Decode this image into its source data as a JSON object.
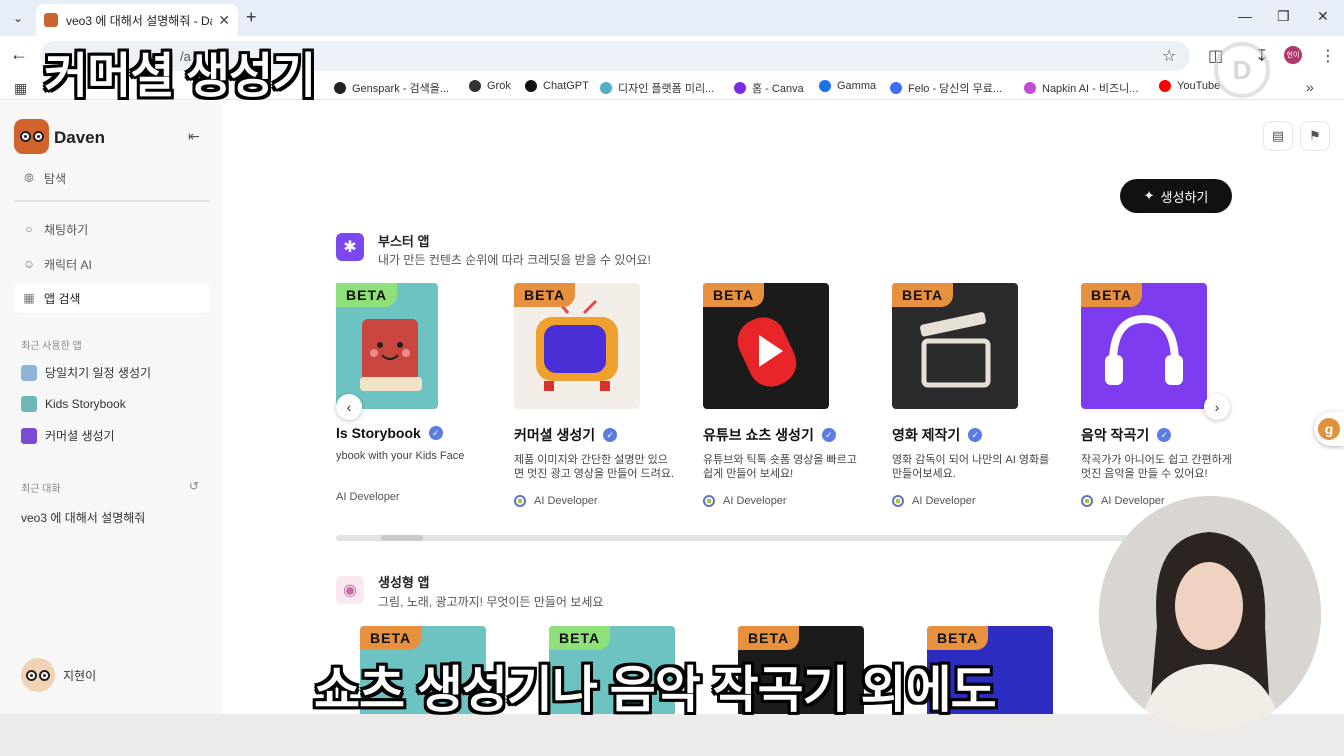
{
  "browser": {
    "tab_title": "veo3 에 대해서 설명해줘 - Da",
    "url_fragment": "/a",
    "profile_label": "현이"
  },
  "bookmarks": [
    {
      "label": "Genspark - 검색을...",
      "color": "#222222"
    },
    {
      "label": "Grok",
      "color": "#333333"
    },
    {
      "label": "ChatGPT",
      "color": "#111111"
    },
    {
      "label": "디자인 플랫폼 미리...",
      "color": "#4fb0c6"
    },
    {
      "label": "홈 - Canva",
      "color": "#7d2ae8"
    },
    {
      "label": "Gamma",
      "color": "#1a73e8"
    },
    {
      "label": "Felo - 당신의 무료...",
      "color": "#3b6ef5"
    },
    {
      "label": "Napkin AI - 비즈니...",
      "color": "#c04bd0"
    },
    {
      "label": "YouTube",
      "color": "#ff0000"
    }
  ],
  "captions": {
    "top": "커머셜 생성기",
    "bottom": "쇼츠 생성기나 음악 작곡기 외에도",
    "watermark": "D"
  },
  "sidebar": {
    "brand": "Daven",
    "explore": "탐색",
    "nav": [
      {
        "label": "채팅하기",
        "icon": "chat-icon"
      },
      {
        "label": "캐릭터 AI",
        "icon": "person-icon"
      },
      {
        "label": "앱 검색",
        "icon": "grid-icon"
      }
    ],
    "recent_apps_title": "최근 사용한 앱",
    "recent_apps": [
      {
        "label": "당일치기 일정 생성기",
        "color": "#8fb6d8"
      },
      {
        "label": "Kids Storybook",
        "color": "#6fb7b4"
      },
      {
        "label": "커머셜 생성기",
        "color": "#7b4bd6"
      }
    ],
    "recent_chats_title": "최근 대화",
    "recent_chats": [
      "veo3 에 대해서 설명해줘"
    ],
    "user_name": "지현이"
  },
  "main": {
    "create_button": "생성하기",
    "booster": {
      "title": "부스터 앱",
      "subtitle": "내가 만든 컨텐츠 순위에 따라 크레딧을 받을 수 있어요!"
    },
    "generative": {
      "title": "생성형 앱",
      "subtitle": "그림, 노래, 광고까지! 무엇이든 만들어 보세요"
    },
    "beta_label": "BETA",
    "cards": [
      {
        "name": "ls Storybook",
        "desc": "ybook with your Kids Face",
        "dev": "AI Developer",
        "bg": "#6cc3c1",
        "badge": "#8ee07a"
      },
      {
        "name": "커머셜 생성기",
        "desc": "제품 이미지와 간단한 설명만 있으\n면 멋진 광고 영상을 만들어 드려요.",
        "dev": "AI Developer",
        "bg": "#f3eee8",
        "badge": "#e7913f"
      },
      {
        "name": "유튜브 쇼츠 생성기",
        "desc": "유튜브와 틱톡 숏폼 영상을 빠르고\n쉽게 만들어 보세요!",
        "dev": "AI Developer",
        "bg": "#1b1b1b",
        "badge": "#e7913f"
      },
      {
        "name": "영화 제작기",
        "desc": "영화 감독이 되어 나만의 AI 영화를\n만들어보세요.",
        "dev": "AI Developer",
        "bg": "#2b2b2b",
        "badge": "#e7913f"
      },
      {
        "name": "음악 작곡기",
        "desc": "작곡가가 아니어도 쉽고 간편하게\n멋진 음악을 만들 수 있어요!",
        "dev": "AI Developer",
        "bg": "#7d3cf0",
        "badge": "#e7913f"
      }
    ],
    "generative_cards": [
      {
        "bg": "#6cc3c1",
        "badge": "#e7913f"
      },
      {
        "bg": "#6cc3c1",
        "badge": "#8ee07a"
      },
      {
        "bg": "#1b1b1b",
        "badge": "#e7913f"
      },
      {
        "bg": "#2c2cc0",
        "badge": "#e7913f"
      }
    ],
    "scroll_position": 0.05
  },
  "floating_badge": "g"
}
